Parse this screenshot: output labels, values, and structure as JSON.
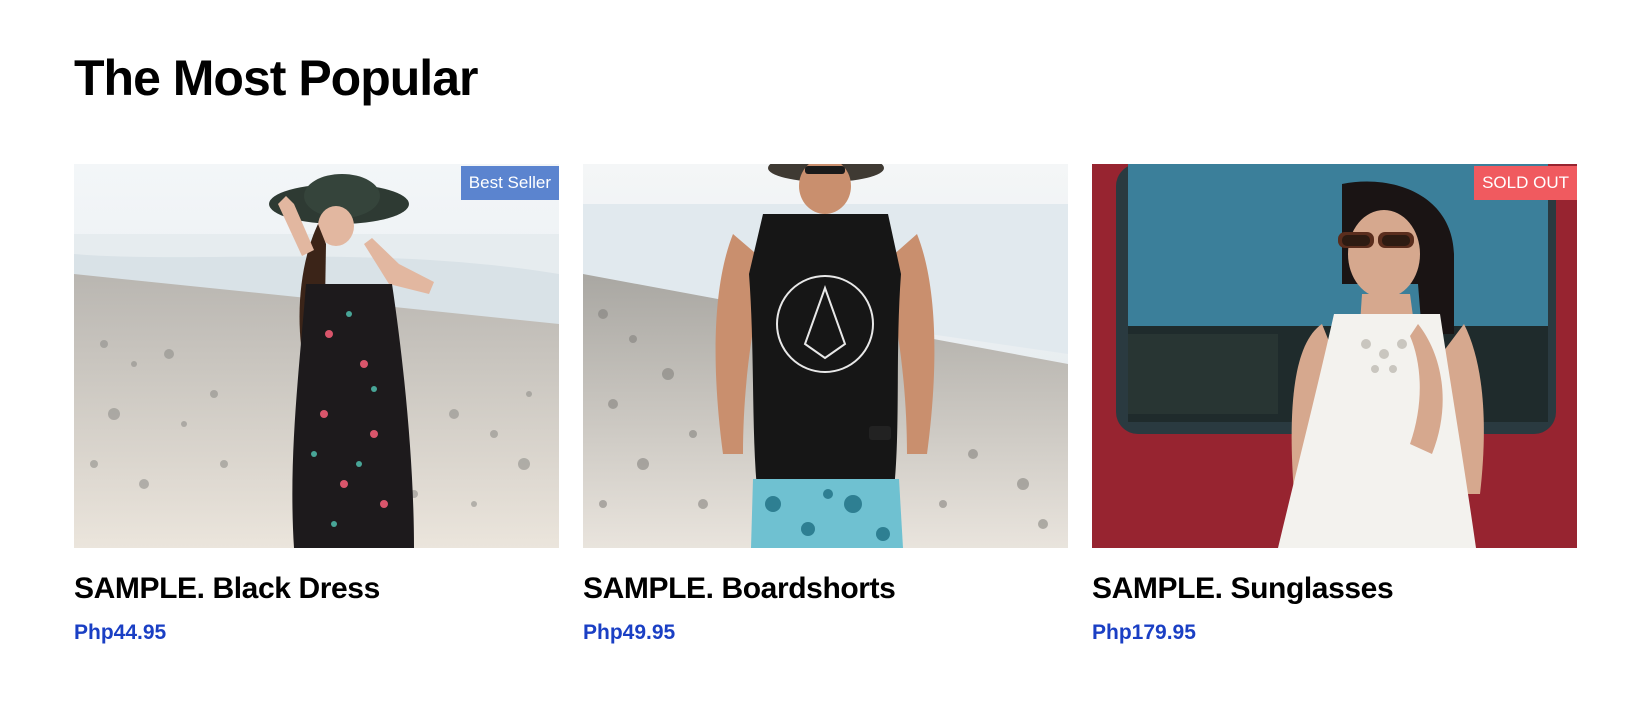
{
  "section": {
    "title": "The Most Popular"
  },
  "products": [
    {
      "name": "SAMPLE. Black Dress",
      "price": "Php44.95",
      "badge": "Best Seller",
      "image": "woman-beach-black-floral-dress"
    },
    {
      "name": "SAMPLE. Boardshorts",
      "price": "Php49.95",
      "badge": "",
      "image": "man-beach-tank-boardshorts"
    },
    {
      "name": "SAMPLE. Sunglasses",
      "price": "Php179.95",
      "badge": "SOLD OUT",
      "image": "woman-sunglasses-white-dress-red-van"
    }
  ],
  "colors": {
    "price": "#1a3fc4",
    "badge_best_seller": "#5b84cf",
    "badge_sold_out": "#f05a5f"
  }
}
